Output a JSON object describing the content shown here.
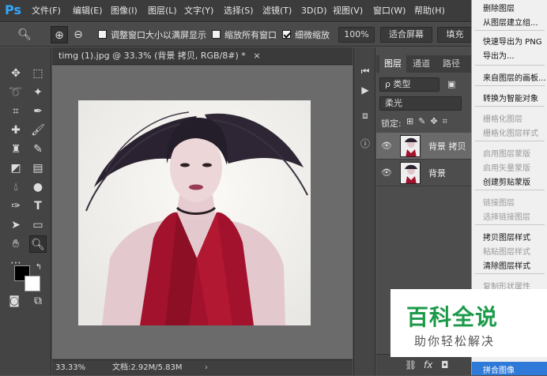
{
  "app": {
    "logo": "Ps"
  },
  "menubar": {
    "items": [
      "文件(F)",
      "编辑(E)",
      "图像(I)",
      "图层(L)",
      "文字(Y)",
      "选择(S)",
      "滤镜(T)",
      "3D(D)",
      "视图(V)",
      "窗口(W)",
      "帮助(H)"
    ]
  },
  "options": {
    "resize_label": "调整窗口大小以满屏显示",
    "zoom_all_label": "缩放所有窗口",
    "scrubby_label": "细微缩放",
    "zoom_value": "100%",
    "fit_screen": "适合屏幕",
    "fill_screen": "填充"
  },
  "document": {
    "tab_title": "timg (1).jpg @ 33.3% (背景 拷贝, RGB/8#) *",
    "close": "×"
  },
  "status": {
    "zoom": "33.33%",
    "doc_info": "文档:2.92M/5.83M"
  },
  "layers_panel": {
    "tabs": [
      "图层",
      "通道",
      "路径"
    ],
    "filter_label": "ρ 类型",
    "blend_mode": "柔光",
    "lock_label": "锁定:",
    "layers": [
      {
        "name": "背景 拷贝",
        "selected": true
      },
      {
        "name": "背景",
        "selected": false
      }
    ]
  },
  "context_menu": {
    "items": [
      {
        "label": "删除图层",
        "enabled": true
      },
      {
        "label": "从图层建立组...",
        "enabled": true
      },
      {
        "label": "快速导出为 PNG",
        "enabled": true
      },
      {
        "label": "导出为...",
        "enabled": true
      },
      {
        "label": "来自图层的画板...",
        "enabled": true
      },
      {
        "label": "转换为智能对象",
        "enabled": true
      },
      {
        "label": "栅格化图层",
        "enabled": false
      },
      {
        "label": "栅格化图层样式",
        "enabled": false
      },
      {
        "label": "启用图层蒙版",
        "enabled": false
      },
      {
        "label": "启用矢量蒙版",
        "enabled": false
      },
      {
        "label": "创建剪贴蒙版",
        "enabled": true
      },
      {
        "label": "链接图层",
        "enabled": false
      },
      {
        "label": "选择链接图层",
        "enabled": false
      },
      {
        "label": "拷贝图层样式",
        "enabled": true
      },
      {
        "label": "粘贴图层样式",
        "enabled": false
      },
      {
        "label": "清除图层样式",
        "enabled": true
      },
      {
        "label": "复制形状属性",
        "enabled": false
      },
      {
        "label": "拼合图像",
        "enabled": true,
        "highlighted": true
      }
    ]
  },
  "watermark": {
    "title": "百科全说",
    "subtitle": "助你轻松解决"
  },
  "colors": {
    "accent": "#31a8ff",
    "menu_highlight": "#2f7ad8",
    "watermark_green": "#1c9a4a"
  }
}
